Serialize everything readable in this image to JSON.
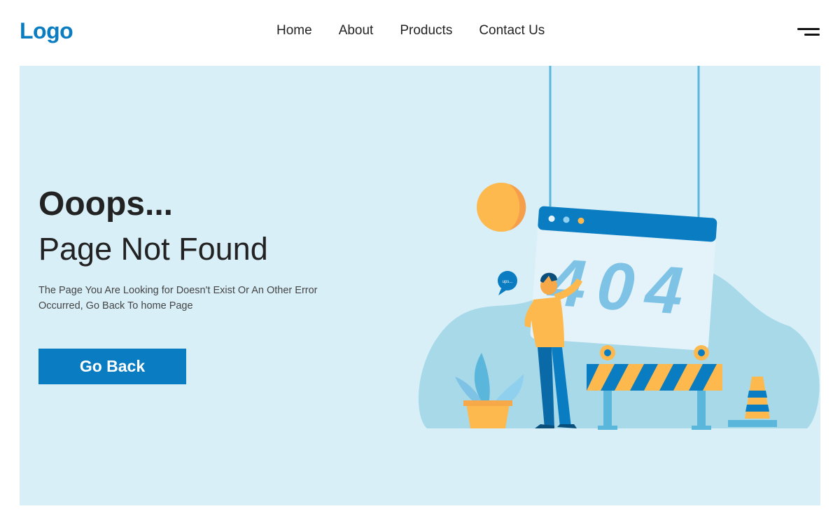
{
  "header": {
    "logo": "Logo",
    "nav": [
      {
        "label": "Home"
      },
      {
        "label": "About"
      },
      {
        "label": "Products"
      },
      {
        "label": "Contact Us"
      }
    ]
  },
  "hero": {
    "headline": "Ooops...",
    "subheadline": "Page Not Found",
    "message": "The Page You Are Looking for Doesn't Exist Or An Other Error Occurred, Go Back To home Page",
    "button_label": "Go Back"
  },
  "illustration": {
    "sign_text": "404",
    "speech_bubble": "ups..."
  },
  "colors": {
    "accent": "#0a7cc1",
    "hero_bg": "#d8eff8",
    "sun": "#fdb94e",
    "digits": "#7ec3e6"
  }
}
